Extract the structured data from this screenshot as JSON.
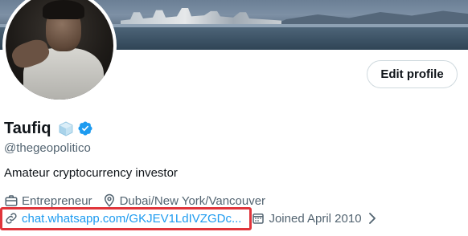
{
  "profile": {
    "name": "Taufiq",
    "handle": "@thegeopolitico",
    "bio": "Amateur cryptocurrency investor",
    "edit_button": "Edit profile",
    "occupation": "Entrepreneur",
    "location": "Dubai/New York/Vancouver",
    "website": "chat.whatsapp.com/GKJEV1LdIVZGDc...",
    "joined": "Joined April 2010"
  },
  "icons": {
    "name_emoji": "ice-cube-icon",
    "verified": "verified-badge-icon",
    "occupation": "briefcase-icon",
    "location": "location-pin-icon",
    "website": "link-icon",
    "joined": "calendar-icon",
    "joined_chevron": "chevron-right-icon"
  },
  "colors": {
    "accent": "#1d9bf0",
    "secondary_text": "#536471",
    "highlight": "#e0353b"
  }
}
